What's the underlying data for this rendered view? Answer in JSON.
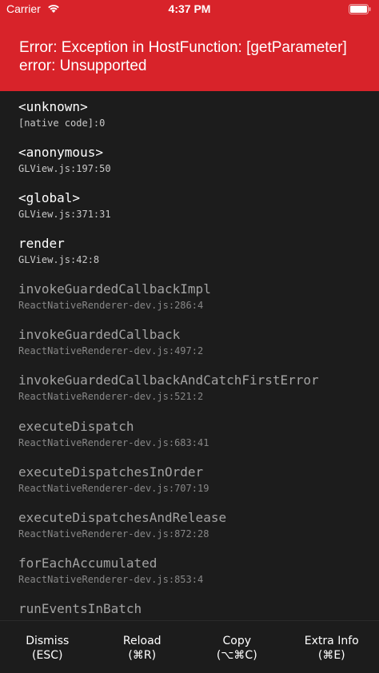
{
  "status_bar": {
    "carrier": "Carrier",
    "time": "4:37 PM"
  },
  "error": {
    "message": "Error: Exception in HostFunction: [getParameter] error: Unsupported"
  },
  "stack": [
    {
      "fn": "<unknown>",
      "loc": "[native code]:0"
    },
    {
      "fn": "<anonymous>",
      "loc": "GLView.js:197:50"
    },
    {
      "fn": "<global>",
      "loc": "GLView.js:371:31"
    },
    {
      "fn": "render",
      "loc": "GLView.js:42:8"
    },
    {
      "fn": "invokeGuardedCallbackImpl",
      "loc": "ReactNativeRenderer-dev.js:286:4"
    },
    {
      "fn": "invokeGuardedCallback",
      "loc": "ReactNativeRenderer-dev.js:497:2"
    },
    {
      "fn": "invokeGuardedCallbackAndCatchFirstError",
      "loc": "ReactNativeRenderer-dev.js:521:2"
    },
    {
      "fn": "executeDispatch",
      "loc": "ReactNativeRenderer-dev.js:683:41"
    },
    {
      "fn": "executeDispatchesInOrder",
      "loc": "ReactNativeRenderer-dev.js:707:19"
    },
    {
      "fn": "executeDispatchesAndRelease",
      "loc": "ReactNativeRenderer-dev.js:872:28"
    },
    {
      "fn": "forEachAccumulated",
      "loc": "ReactNativeRenderer-dev.js:853:4"
    },
    {
      "fn": "runEventsInBatch",
      "loc": ""
    }
  ],
  "footer": {
    "dismiss": {
      "label": "Dismiss",
      "shortcut": "(ESC)"
    },
    "reload": {
      "label": "Reload",
      "shortcut": "(⌘R)"
    },
    "copy": {
      "label": "Copy",
      "shortcut": "(⌥⌘C)"
    },
    "extra": {
      "label": "Extra Info",
      "shortcut": "(⌘E)"
    }
  },
  "colors": {
    "accent": "#d8232a",
    "background": "#1c1c1c"
  },
  "icons": {
    "wifi": "wifi-icon",
    "battery": "battery-icon"
  }
}
